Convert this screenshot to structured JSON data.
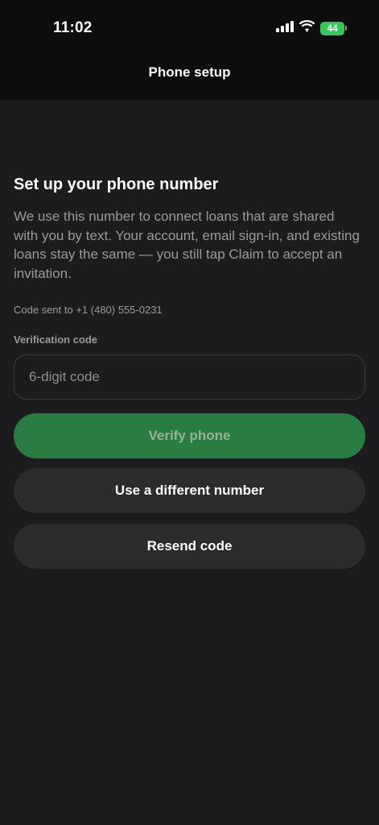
{
  "status_bar": {
    "time": "11:02",
    "battery_level": "44",
    "icons": [
      "signal-icon",
      "wifi-icon",
      "battery-icon"
    ]
  },
  "nav": {
    "title": "Phone setup"
  },
  "main": {
    "heading": "Set up your phone number",
    "description": "We use this number to connect loans that are shared with you by text. Your account, email sign-in, and existing loans stay the same — you still tap Claim to accept an invitation.",
    "code_sent": "Code sent to +1 (480) 555-0231",
    "field_label": "Verification code",
    "code_input": {
      "value": "",
      "placeholder": "6-digit code"
    },
    "verify_button": "Verify phone",
    "different_number_button": "Use a different number",
    "resend_button": "Resend code"
  },
  "colors": {
    "background": "#1c1c1e",
    "header": "#0d0d0d",
    "primary_button": "#2b7c43",
    "secondary_button": "#2c2c2e",
    "battery": "#34c759"
  }
}
